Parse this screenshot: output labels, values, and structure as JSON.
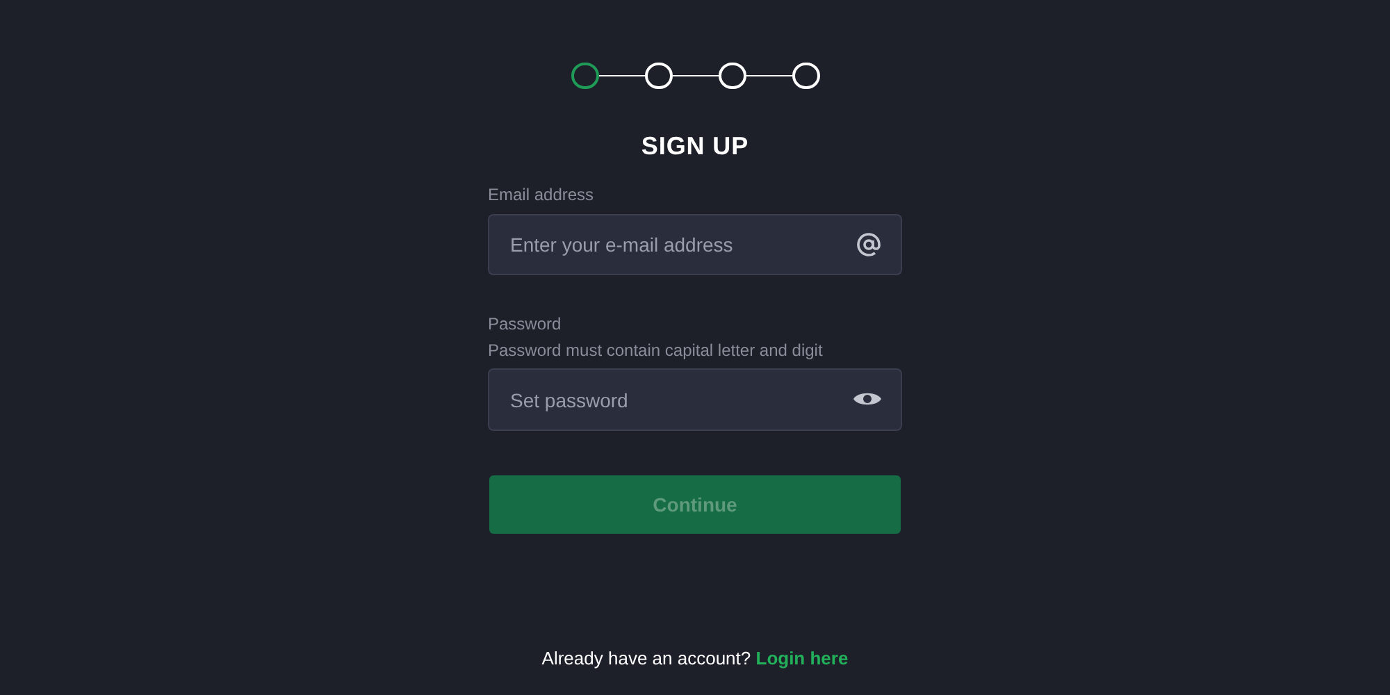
{
  "steps": [
    {
      "selected": true
    },
    {
      "selected": false
    },
    {
      "selected": false
    },
    {
      "selected": false
    }
  ],
  "title": "SIGN UP",
  "email": {
    "label": "Email address",
    "placeholder": "Enter your e-mail address"
  },
  "password": {
    "label": "Password",
    "hint": "Password must contain capital letter and digit",
    "placeholder": "Set password"
  },
  "continue_button": {
    "label": "Continue",
    "disabled": true
  },
  "footer": {
    "text": "Already have an account?",
    "link": "Login here"
  }
}
